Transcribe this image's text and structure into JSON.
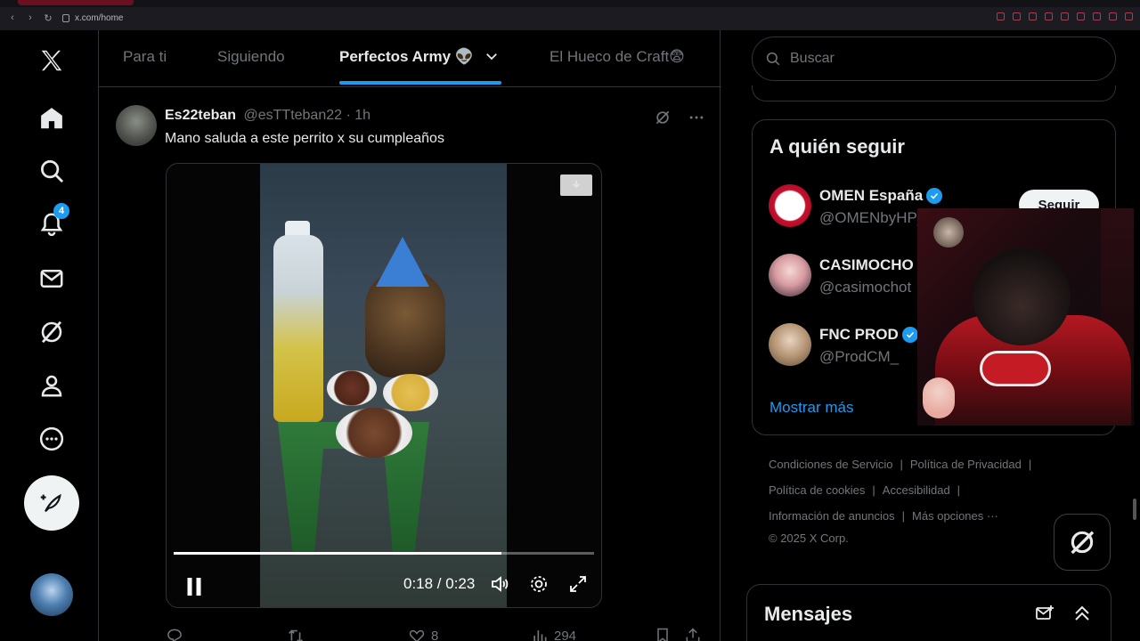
{
  "browser": {
    "url": "x.com/home"
  },
  "nav": {
    "notifications_badge": "4"
  },
  "tabs": [
    {
      "label": "Para ti"
    },
    {
      "label": "Siguiendo"
    },
    {
      "label": "Perfectos Army 👽"
    },
    {
      "label": "El Hueco de Craft😨"
    }
  ],
  "tweet": {
    "name": "Es22teban",
    "handle": "@esTTteban22 · 1h",
    "text": "Mano saluda a este perrito x su cumpleaños",
    "video": {
      "time": "0:18 / 0:23",
      "progress": 0.78
    },
    "actions": {
      "likes": "8",
      "views": "294"
    }
  },
  "search": {
    "placeholder": "Buscar"
  },
  "who_to_follow": {
    "title": "A quién seguir",
    "follow_label": "Seguir",
    "accounts": [
      {
        "name": "OMEN España",
        "handle": "@OMENbyHP_es",
        "verified": true
      },
      {
        "name": "CASIMOCHO",
        "handle": "@casimochot",
        "verified": false
      },
      {
        "name": "FNC PROD",
        "handle": "@ProdCM_",
        "verified": true
      }
    ],
    "show_more": "Mostrar más"
  },
  "footer": {
    "links": [
      "Condiciones de Servicio",
      "Política de Privacidad",
      "Política de cookies",
      "Accesibilidad",
      "Información de anuncios",
      "Más opciones ···"
    ],
    "copyright": "© 2025 X Corp."
  },
  "messages": {
    "title": "Mensajes"
  },
  "colors": {
    "accent": "#1d9bf0",
    "background": "#000000",
    "muted": "#71767b",
    "text": "#e7e9ea"
  }
}
